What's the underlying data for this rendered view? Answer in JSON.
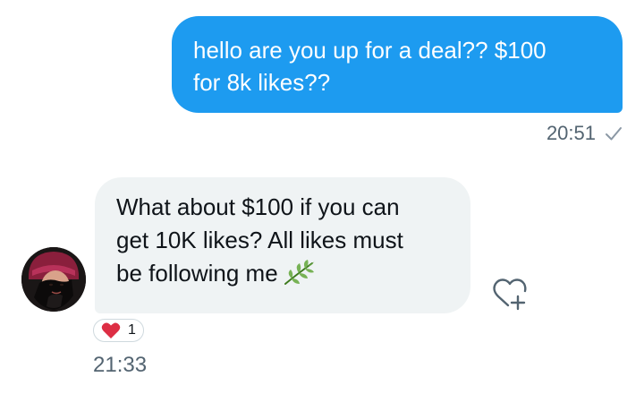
{
  "outgoing": {
    "line1": "hello are you up for a deal?? $100",
    "line2": "for 8k likes??",
    "time": "20:51",
    "status_icon": "check-icon"
  },
  "incoming": {
    "line1": "What about $100 if you can",
    "line2": "get 10K likes? All likes must",
    "line3": "be following me",
    "emoji": "herb",
    "time": "21:33",
    "reaction": {
      "emoji": "red-heart",
      "count": "1"
    }
  },
  "colors": {
    "outgoing_bubble": "#1d9bf0",
    "incoming_bubble": "#eff3f4",
    "timestamp": "#536471",
    "heart": "#e0245e"
  }
}
